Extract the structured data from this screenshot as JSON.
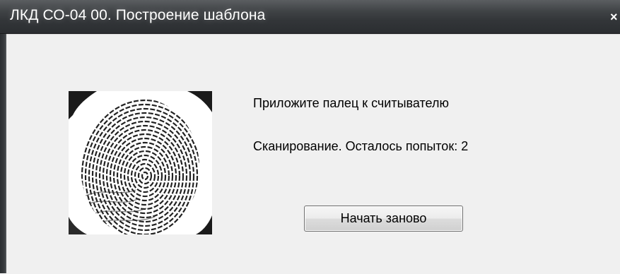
{
  "window": {
    "title": "ЛКД СО-04 00. Построение шаблона",
    "close_glyph": "×"
  },
  "main": {
    "prompt_text": "Приложите палец к считывателю",
    "status_text": "Сканирование. Осталось попыток: 2",
    "restart_label": "Начать заново"
  },
  "icons": {
    "fingerprint": "fingerprint-scan-image",
    "close": "close-icon"
  },
  "colors": {
    "title_bar": "#3f4245",
    "client_bg": "#f0f0f0",
    "title_text": "#ffffff"
  }
}
